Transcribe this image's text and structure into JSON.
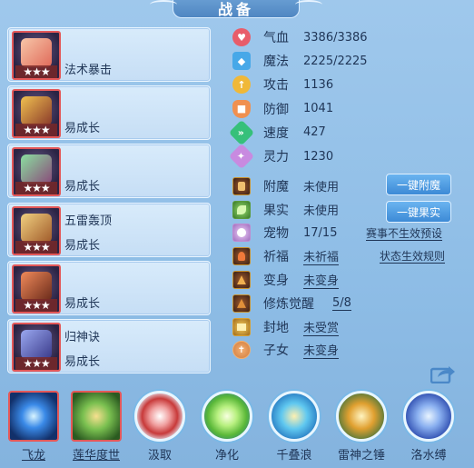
{
  "title": "战备",
  "equipment": [
    {
      "name": "法术暴击",
      "stars": "★★★",
      "art_color": "#e88a6a"
    },
    {
      "name": "易成长",
      "stars": "★★★",
      "art_color": "#d8a040"
    },
    {
      "name": "易成长",
      "stars": "★★★",
      "art_color": "#5fb87a"
    },
    {
      "name_top": "五雷轰顶",
      "name": "易成长",
      "stars": "★★★",
      "art_color": "#e0b04a"
    },
    {
      "name": "易成长",
      "stars": "★★★",
      "art_color": "#d65a3a"
    },
    {
      "name_top": "归神诀",
      "name": "易成长",
      "stars": "★★★",
      "art_color": "#7a8ee0"
    }
  ],
  "stats": [
    {
      "label": "气血",
      "value": "3386/3386",
      "icon": "heart-icon",
      "color": "#e85d6a"
    },
    {
      "label": "魔法",
      "value": "2225/2225",
      "icon": "mana-icon",
      "color": "#47a8e8"
    },
    {
      "label": "攻击",
      "value": "1136",
      "icon": "attack-icon",
      "color": "#f0b838"
    },
    {
      "label": "防御",
      "value": "1041",
      "icon": "defense-icon",
      "color": "#f09050"
    },
    {
      "label": "速度",
      "value": "427",
      "icon": "speed-icon",
      "color": "#36c07a"
    },
    {
      "label": "灵力",
      "value": "1230",
      "icon": "spirit-icon",
      "color": "#c88ae0"
    }
  ],
  "attachments": [
    {
      "label": "附魔",
      "value": "未使用",
      "icon": "enchant-icon"
    },
    {
      "label": "果实",
      "value": "未使用",
      "icon": "fruit-icon"
    },
    {
      "label": "宠物",
      "value": "17/15",
      "icon": "pet-icon"
    },
    {
      "label": "祈福",
      "value": "未祈福",
      "icon": "bless-icon"
    },
    {
      "label": "变身",
      "value": "未变身",
      "icon": "transform-icon"
    },
    {
      "label": "修炼觉醒",
      "value": "5/8",
      "icon": "cultivation-icon"
    },
    {
      "label": "封地",
      "value": "未受赏",
      "icon": "fief-icon"
    },
    {
      "label": "子女",
      "value": "未变身",
      "icon": "children-icon"
    }
  ],
  "buttons": {
    "one_click_enchant": "一键附魔",
    "one_click_fruit": "一键果实"
  },
  "links": {
    "season_preset": "赛事不生效预设",
    "status_rules": "状态生效规则"
  },
  "skills": [
    {
      "label": "飞龙",
      "style": "square",
      "color": "#3a7ad8"
    },
    {
      "label": "莲华度世",
      "style": "square",
      "color": "#5fae4a"
    },
    {
      "label": "汲取",
      "style": "round",
      "color": "#d84a4a"
    },
    {
      "label": "净化",
      "style": "round",
      "color": "#7ad04a"
    },
    {
      "label": "千叠浪",
      "style": "round",
      "color": "#3ab0e0"
    },
    {
      "label": "雷神之锤",
      "style": "round",
      "color": "#d0a030"
    },
    {
      "label": "洛水缚",
      "style": "round",
      "color": "#4a78d8"
    }
  ]
}
